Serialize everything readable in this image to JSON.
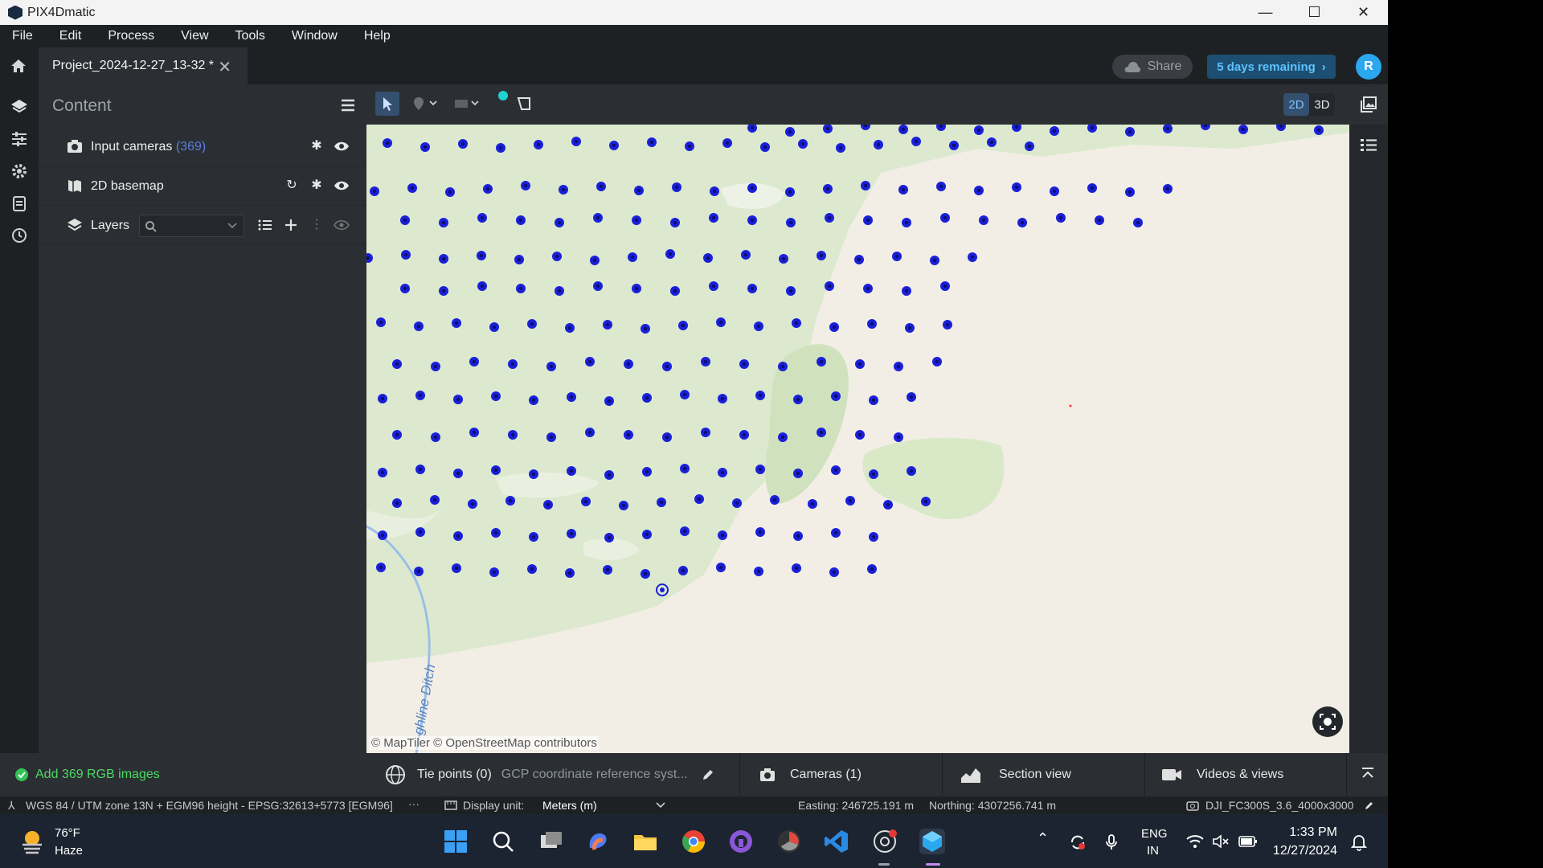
{
  "app": {
    "title": "PIX4Dmatic",
    "window_controls": [
      "—",
      "☐",
      "✕"
    ]
  },
  "menu": [
    "File",
    "Edit",
    "Process",
    "View",
    "Tools",
    "Window",
    "Help"
  ],
  "tab": {
    "title": "Project_2024-12-27_13-32 *",
    "close": "✕"
  },
  "header": {
    "share_label": "Share",
    "trial_label": "5 days remaining",
    "trial_chevron": "›",
    "avatar_initial": "R"
  },
  "content_panel": {
    "title": "Content",
    "input_cameras_label": "Input cameras",
    "input_cameras_count": "(369)",
    "basemap_label": "2D basemap",
    "layers_label": "Layers"
  },
  "view_toggle": {
    "label_2d": "2D",
    "label_3d": "3D",
    "active": "2D"
  },
  "map": {
    "attribution": "© MapTiler  © OpenStreetMap contributors",
    "waterway_label": "ghline Ditch",
    "camera_color": "#1a20d8"
  },
  "bottom": {
    "task_label": "Add 369 RGB images",
    "tie_points_label": "Tie points (0)",
    "gcp_label": "GCP coordinate reference syst...",
    "cameras_label": "Cameras (1)",
    "section_view_label": "Section view",
    "videos_label": "Videos & views"
  },
  "status": {
    "crs": "WGS 84 / UTM zone 13N + EGM96 height - EPSG:32613+5773 [EGM96]",
    "crs_more": "···",
    "display_unit_label": "Display unit:",
    "display_unit_value": "Meters (m)",
    "easting": "Easting: 246725.191 m",
    "northing": "Northing: 4307256.741 m",
    "camera_model": "DJI_FC300S_3.6_4000x3000"
  },
  "taskbar": {
    "temp": "76°F",
    "weather": "Haze",
    "lang": "ENG",
    "region": "IN",
    "time": "1:33 PM",
    "date": "12/27/2024"
  },
  "colors": {
    "accent": "#2aa7ef",
    "trial_bg": "#1d4f73",
    "map_bg": "#f2eee6",
    "vegetation": "#dbe8cf",
    "water": "#9bbfe6"
  }
}
